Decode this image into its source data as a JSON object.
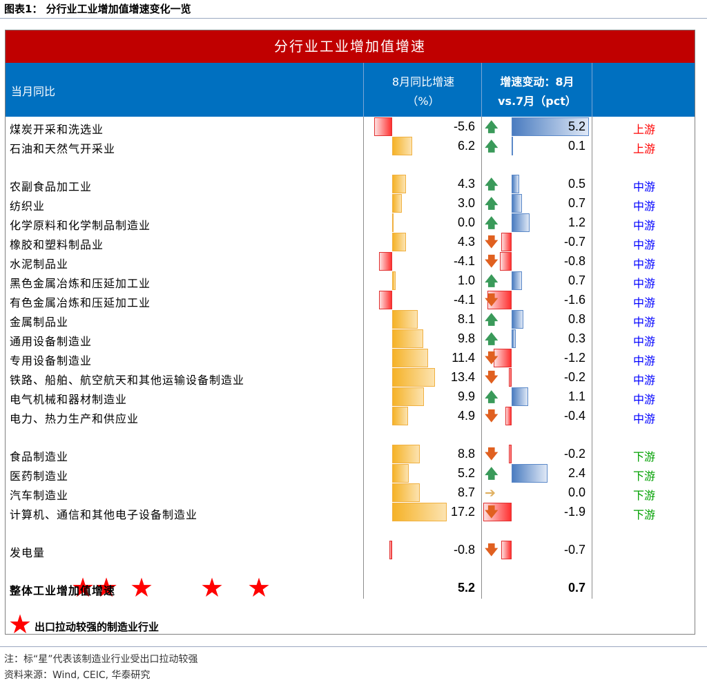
{
  "figure": {
    "title": "图表1：  分行业工业增加值增速变化一览",
    "banner": "分行业工业增加值增速",
    "headers": {
      "label": "当月同比",
      "yoy_line1": "8月同比增速",
      "yoy_line2": "（%）",
      "chg_line1": "增速变动：8月",
      "chg_line2": "vs.7月（pct）"
    },
    "legend": "出口拉动较强的制造业行业",
    "note": "注：标“星”代表该制造业行业受出口拉动较强",
    "source": "资料来源：Wind, CEIC, 华泰研究"
  },
  "colors": {
    "banner": "#c00000",
    "header": "#0070c0",
    "upstream": "#ff0000",
    "midstream": "#0000ff",
    "downstream": "#00a000",
    "arrow_up": "#3a9a5a",
    "arrow_down": "#e06020",
    "arrow_flat": "#e0b060",
    "star": "#ff0000"
  },
  "chart_data": {
    "type": "table",
    "columns": [
      "当月同比",
      "8月同比增速（%）",
      "增速变动：8月 vs.7月（pct）",
      ""
    ],
    "rows": [
      {
        "name": "煤炭开采和洗选业",
        "yoy": -5.6,
        "yoy_text": "-5.6",
        "chg": 5.2,
        "chg_text": "5.2",
        "dir": "up",
        "region": "上游",
        "star": false,
        "group": 0
      },
      {
        "name": "石油和天然气开采业",
        "yoy": 6.2,
        "yoy_text": "6.2",
        "chg": 0.1,
        "chg_text": "0.1",
        "dir": "up",
        "region": "上游",
        "star": false,
        "group": 0
      },
      {
        "name": "农副食品加工业",
        "yoy": 4.3,
        "yoy_text": "4.3",
        "chg": 0.5,
        "chg_text": "0.5",
        "dir": "up",
        "region": "中游",
        "star": false,
        "group": 1
      },
      {
        "name": "纺织业",
        "yoy": 3.0,
        "yoy_text": "3.0",
        "chg": 0.7,
        "chg_text": "0.7",
        "dir": "up",
        "region": "中游",
        "star": false,
        "group": 1
      },
      {
        "name": "化学原料和化学制品制造业",
        "yoy": 0.0,
        "yoy_text": "0.0",
        "chg": 1.2,
        "chg_text": "1.2",
        "dir": "up",
        "region": "中游",
        "star": false,
        "group": 1
      },
      {
        "name": "橡胶和塑料制品业",
        "yoy": 4.3,
        "yoy_text": "4.3",
        "chg": -0.7,
        "chg_text": "-0.7",
        "dir": "down",
        "region": "中游",
        "star": false,
        "group": 1
      },
      {
        "name": "水泥制品业",
        "yoy": -4.1,
        "yoy_text": "-4.1",
        "chg": -0.8,
        "chg_text": "-0.8",
        "dir": "down",
        "region": "中游",
        "star": false,
        "group": 1
      },
      {
        "name": "黑色金属冶炼和压延加工业",
        "yoy": 1.0,
        "yoy_text": "1.0",
        "chg": 0.7,
        "chg_text": "0.7",
        "dir": "up",
        "region": "中游",
        "star": false,
        "group": 1
      },
      {
        "name": "有色金属冶炼和压延加工业",
        "yoy": -4.1,
        "yoy_text": "-4.1",
        "chg": -1.6,
        "chg_text": "-1.6",
        "dir": "down",
        "region": "中游",
        "star": false,
        "group": 1
      },
      {
        "name": "金属制品业",
        "yoy": 8.1,
        "yoy_text": "8.1",
        "chg": 0.8,
        "chg_text": "0.8",
        "dir": "up",
        "region": "中游",
        "star": false,
        "group": 1
      },
      {
        "name": "通用设备制造业",
        "yoy": 9.8,
        "yoy_text": "9.8",
        "chg": 0.3,
        "chg_text": "0.3",
        "dir": "up",
        "region": "中游",
        "star": true,
        "group": 1
      },
      {
        "name": "专用设备制造业",
        "yoy": 11.4,
        "yoy_text": "11.4",
        "chg": -1.2,
        "chg_text": "-1.2",
        "dir": "down",
        "region": "中游",
        "star": true,
        "group": 1
      },
      {
        "name": "铁路、船舶、航空航天和其他运输设备制造业",
        "yoy": 13.4,
        "yoy_text": "13.4",
        "chg": -0.2,
        "chg_text": "-0.2",
        "dir": "down",
        "region": "中游",
        "star": true,
        "group": 1
      },
      {
        "name": "电气机械和器材制造业",
        "yoy": 9.9,
        "yoy_text": "9.9",
        "chg": 1.1,
        "chg_text": "1.1",
        "dir": "up",
        "region": "中游",
        "star": true,
        "group": 1
      },
      {
        "name": "电力、热力生产和供应业",
        "yoy": 4.9,
        "yoy_text": "4.9",
        "chg": -0.4,
        "chg_text": "-0.4",
        "dir": "down",
        "region": "中游",
        "star": false,
        "group": 1
      },
      {
        "name": "食品制造业",
        "yoy": 8.8,
        "yoy_text": "8.8",
        "chg": -0.2,
        "chg_text": "-0.2",
        "dir": "down",
        "region": "下游",
        "star": false,
        "group": 2
      },
      {
        "name": "医药制造业",
        "yoy": 5.2,
        "yoy_text": "5.2",
        "chg": 2.4,
        "chg_text": "2.4",
        "dir": "up",
        "region": "下游",
        "star": true,
        "group": 2
      },
      {
        "name": "汽车制造业",
        "yoy": 8.7,
        "yoy_text": "8.7",
        "chg": 0.0,
        "chg_text": "0.0",
        "dir": "flat",
        "region": "下游",
        "star": true,
        "group": 2
      },
      {
        "name": "计算机、通信和其他电子设备制造业",
        "yoy": 17.2,
        "yoy_text": "17.2",
        "chg": -1.9,
        "chg_text": "-1.9",
        "dir": "down",
        "region": "下游",
        "star": true,
        "group": 2
      },
      {
        "name": "发电量",
        "yoy": -0.8,
        "yoy_text": "-0.8",
        "chg": -0.7,
        "chg_text": "-0.7",
        "dir": "down",
        "region": "",
        "star": false,
        "group": 3
      },
      {
        "name": "整体工业增加值增速",
        "yoy_text": "5.2",
        "chg_text": "0.7",
        "region": "",
        "star": false,
        "group": 4,
        "bold": true,
        "no_bar": true
      }
    ]
  }
}
